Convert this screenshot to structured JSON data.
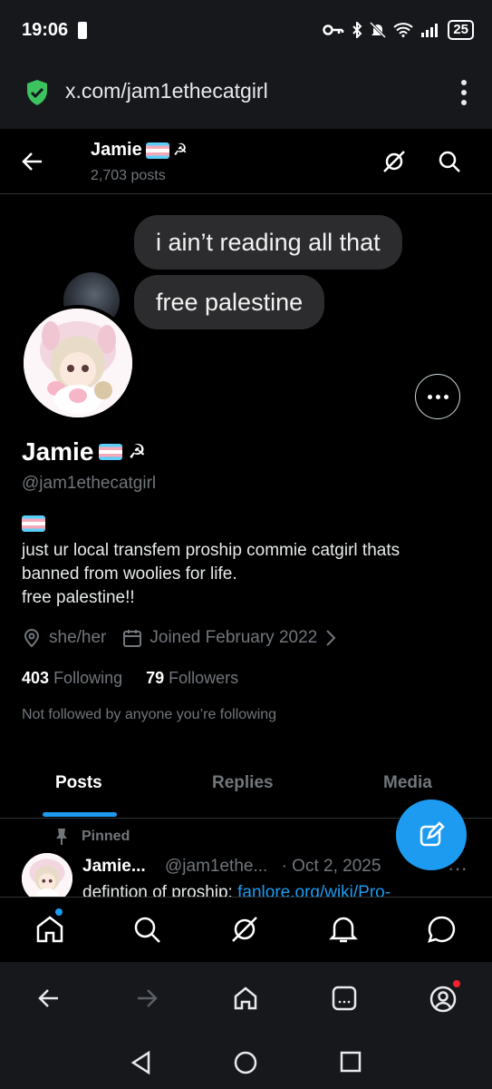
{
  "status_bar": {
    "time": "19:06",
    "battery": "25"
  },
  "browser": {
    "url": "x.com/jam1ethecatgirl"
  },
  "header": {
    "name": "Jamie🏳️‍⚧️☭",
    "name_text": "Jamie",
    "posts_count": "2,703 posts"
  },
  "banner": {
    "line1": "i ain’t reading all that",
    "line2": "free palestine"
  },
  "profile": {
    "name_text": "Jamie",
    "handle": "@jam1ethecatgirl",
    "bio_line1": "just ur local transfem proship commie catgirl thats",
    "bio_line2": "banned from woolies for life.",
    "bio_line3": "free palestine!!",
    "pronouns": "she/her",
    "joined": "Joined February 2022",
    "following_count": "403",
    "following_label": "Following",
    "followers_count": "79",
    "followers_label": "Followers",
    "not_followed": "Not followed by anyone you’re following"
  },
  "tabs": [
    {
      "label": "Posts",
      "active": true
    },
    {
      "label": "Replies",
      "active": false
    },
    {
      "label": "Media",
      "active": false
    }
  ],
  "pinned_post": {
    "pinned_label": "Pinned",
    "author": "Jamie...",
    "handle": "@jam1ethe...",
    "date": "· Oct 2, 2025",
    "text": "defintion of proship: ",
    "link": "fanlore.org/wiki/Pro-"
  },
  "colors": {
    "accent": "#1d9bf0",
    "background": "#000000",
    "secondary_text": "#71767b",
    "browser_chrome": "#16181c",
    "notification_dot": "#f4212e"
  },
  "icons": {
    "header": [
      "back-arrow-icon",
      "grok-icon",
      "search-icon"
    ],
    "bottom_nav": [
      "home-icon",
      "search-icon",
      "grok-icon",
      "notifications-icon",
      "messages-icon"
    ],
    "browser_nav": [
      "back-icon",
      "forward-icon",
      "home-icon",
      "tabs-icon",
      "account-icon"
    ],
    "system_nav": [
      "back-triangle-icon",
      "home-circle-icon",
      "recents-square-icon"
    ]
  }
}
